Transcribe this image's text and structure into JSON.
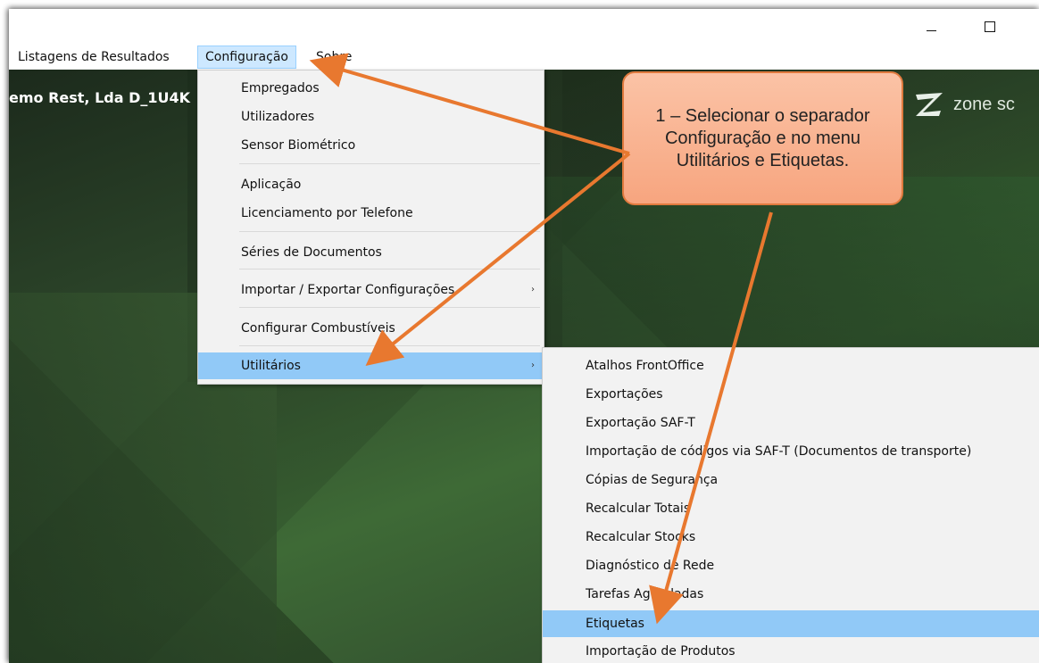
{
  "window": {
    "minimize_icon": "minimize-icon",
    "maximize_icon": "maximize-icon"
  },
  "menubar": {
    "items": [
      "Listagens de Resultados",
      "Configuração",
      "Sobre"
    ]
  },
  "background": {
    "company_text": "emo Rest, Lda D_1U4K",
    "brand_text": "zone sc",
    "brand_icon": "zone-logo-icon"
  },
  "config_menu": {
    "items": [
      "Empregados",
      "Utilizadores",
      "Sensor Biométrico",
      "Aplicação",
      "Licenciamento por Telefone",
      "Séries de Documentos",
      "Importar / Exportar Configurações",
      "Configurar Combustíveis",
      "Utilitários"
    ],
    "submenu_arrow": "›"
  },
  "utilitarios_menu": {
    "items": [
      "Atalhos FrontOffice",
      "Exportações",
      "Exportação SAF-T",
      "Importação de códigos via SAF-T (Documentos de transporte)",
      "Cópias de Segurança",
      "Recalcular Totais",
      "Recalcular Stocks",
      "Diagnóstico de Rede",
      "Tarefas Agendadas",
      "Etiquetas",
      "Importação de Produtos"
    ]
  },
  "callout": {
    "text": "1 – Selecionar o separador Configuração e no menu Utilitários e Etiquetas."
  },
  "colors": {
    "highlight": "#91c9f7",
    "callout_fill": "#f7a57f",
    "arrow": "#e8782f"
  }
}
